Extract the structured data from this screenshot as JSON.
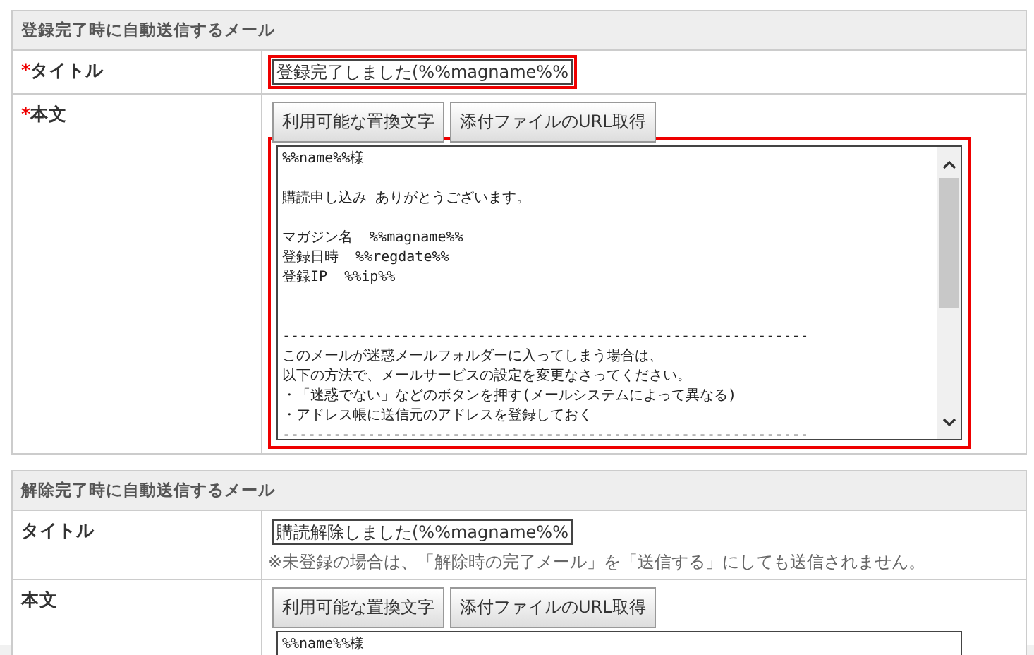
{
  "sections": [
    {
      "heading": "登録完了時に自動送信するメール",
      "rows": [
        {
          "kind": "title",
          "mark": "*",
          "label": "タイトル",
          "value": "登録完了しました(%%magname%%",
          "highlighted": true
        },
        {
          "kind": "body",
          "mark": "*",
          "label": "本文",
          "buttons": [
            "利用可能な置換文字",
            "添付ファイルのURL取得"
          ],
          "highlighted": true,
          "scrollbar": true,
          "lines": [
            {
              "kind": "text",
              "text": "%%name%%様"
            },
            {
              "kind": "blank"
            },
            {
              "kind": "text",
              "text": "購読申し込み ありがとうございます。"
            },
            {
              "kind": "blank"
            },
            {
              "kind": "text",
              "text": "マガジン名  %%magname%%"
            },
            {
              "kind": "text",
              "text": "登録日時  %%regdate%%"
            },
            {
              "kind": "text",
              "text": "登録IP  %%ip%%"
            },
            {
              "kind": "blank"
            },
            {
              "kind": "blank"
            },
            {
              "kind": "text",
              "text": "--------------------------------------------------------------"
            },
            {
              "kind": "text",
              "text": "このメールが迷惑メールフォルダーに入ってしまう場合は、"
            },
            {
              "kind": "text",
              "text": "以下の方法で、メールサービスの設定を変更なさってください。"
            },
            {
              "kind": "text",
              "text": "・「迷惑でない」などのボタンを押す(メールシステムによって異なる)"
            },
            {
              "kind": "text",
              "text": "・アドレス帳に送信元のアドレスを登録しておく"
            },
            {
              "kind": "text",
              "text": "--------------------------------------------------------------"
            }
          ]
        }
      ]
    },
    {
      "heading": "解除完了時に自動送信するメール",
      "rows": [
        {
          "kind": "title",
          "label": "タイトル",
          "value": "購読解除しました(%%magname%%",
          "note": "※未登録の場合は、「解除時の完了メール」を「送信する」にしても送信されません。",
          "highlighted": false
        },
        {
          "kind": "body",
          "label": "本文",
          "buttons": [
            "利用可能な置換文字",
            "添付ファイルのURL取得"
          ],
          "highlighted": false,
          "lines": [
            {
              "kind": "text",
              "text": "%%name%%様"
            }
          ]
        }
      ]
    }
  ]
}
